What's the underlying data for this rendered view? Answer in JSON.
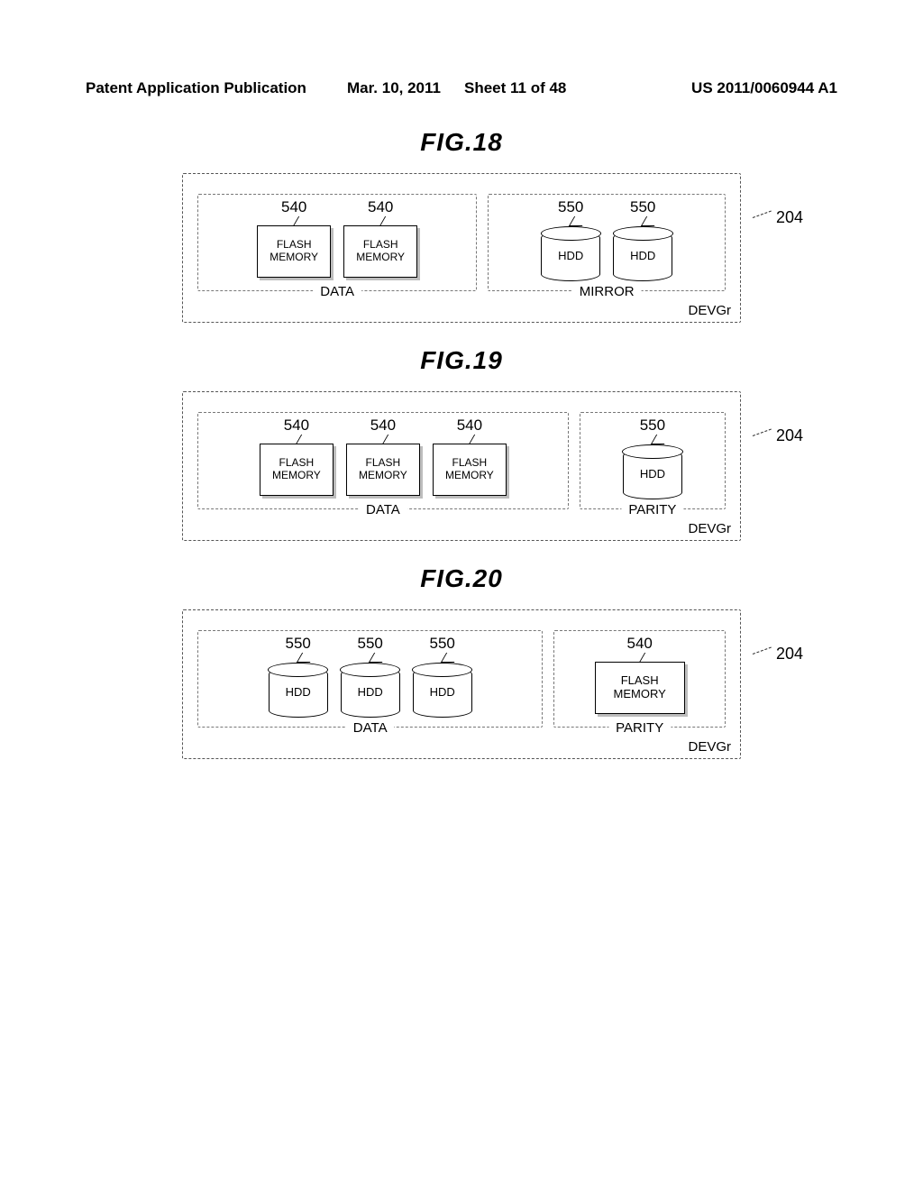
{
  "header": {
    "left": "Patent Application Publication",
    "date": "Mar. 10, 2011",
    "sheet": "Sheet 11 of 48",
    "pubno": "US 2011/0060944 A1"
  },
  "common": {
    "flash_label": "FLASH\nMEMORY",
    "hdd_label": "HDD",
    "devgr": "DEVGr",
    "ref_flash": "540",
    "ref_hdd": "550",
    "ref_outer": "204",
    "grp_data": "DATA",
    "grp_mirror": "MIRROR",
    "grp_parity": "PARITY"
  },
  "figs": {
    "f18": {
      "title": "FIG.18"
    },
    "f19": {
      "title": "FIG.19"
    },
    "f20": {
      "title": "FIG.20"
    }
  }
}
